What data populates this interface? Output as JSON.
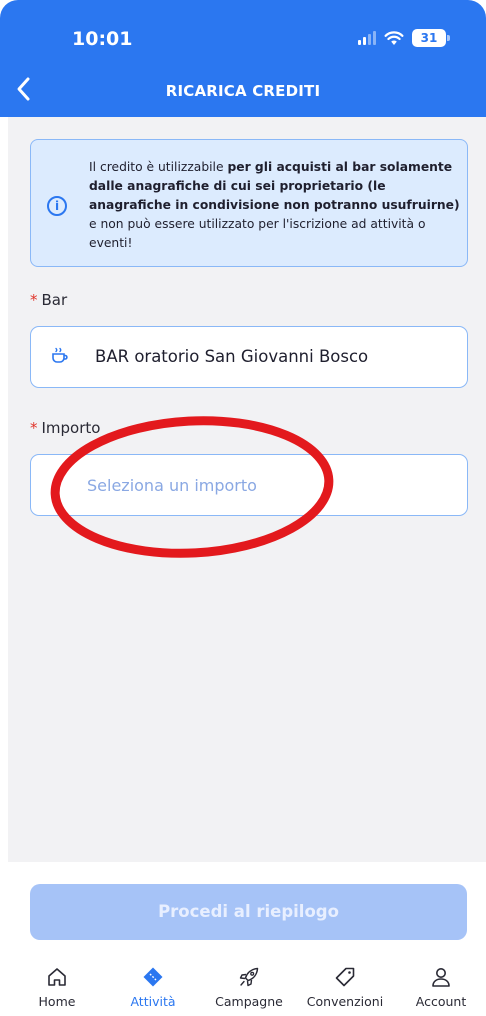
{
  "status_bar": {
    "time": "10:01",
    "battery": "31"
  },
  "header": {
    "title": "RICARICA CREDITI",
    "back_icon": "chevron-left-icon"
  },
  "info_box": {
    "icon": "info-icon",
    "text_1": "Il credito è utilizzabile ",
    "text_2_bold": "per gli acquisti al bar solamente dalle anagrafiche di cui sei proprietario (le anagrafiche in condivisione non potranno usufruirne)",
    "text_3": " e non può essere utilizzato per l'iscrizione ad attività o eventi!"
  },
  "form": {
    "required_mark": "*",
    "bar_label": "Bar",
    "bar_value": "BAR oratorio San Giovanni Bosco",
    "bar_icon": "cup-icon",
    "importo_label": "Importo",
    "importo_placeholder": "Seleziona un importo"
  },
  "proceed_button": "Procedi al riepilogo",
  "tabs": [
    {
      "label": "Home",
      "icon": "home-icon",
      "active": false
    },
    {
      "label": "Attività",
      "icon": "ticket-icon",
      "active": true
    },
    {
      "label": "Campagne",
      "icon": "rocket-icon",
      "active": false
    },
    {
      "label": "Convenzioni",
      "icon": "tag-icon",
      "active": false
    },
    {
      "label": "Account",
      "icon": "user-icon",
      "active": false
    }
  ],
  "colors": {
    "primary": "#2b77f0",
    "info_bg": "#dcebfe",
    "required": "#e0352b",
    "annotation_circle": "#e3191d",
    "disabled_button": "#a6c3f7"
  }
}
